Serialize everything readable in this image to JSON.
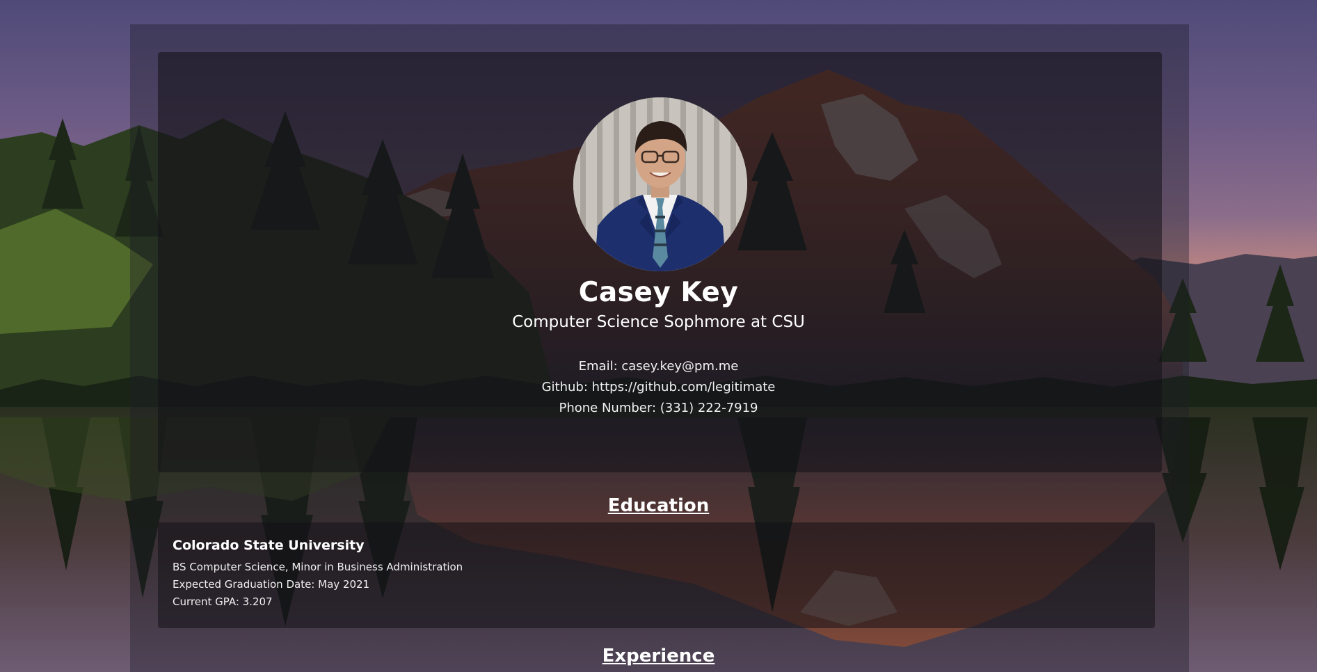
{
  "profile": {
    "name": "Casey Key",
    "tagline": "Computer Science Sophmore at CSU",
    "email_line": "Email: casey.key@pm.me",
    "github_line": "Github: https://github.com/legitimate",
    "phone_line": "Phone Number: (331) 222-7919"
  },
  "education": {
    "heading": "Education",
    "school": "Colorado State University",
    "degree": "BS Computer Science, Minor in Business Administration",
    "graduation": "Expected Graduation Date: May 2021",
    "gpa": "Current GPA: 3.207"
  },
  "experience": {
    "heading": "Experience"
  },
  "colors": {
    "text": "#ffffff",
    "card_background": "rgba(18,16,22,0.55)",
    "suit": "#1e2f6e"
  }
}
